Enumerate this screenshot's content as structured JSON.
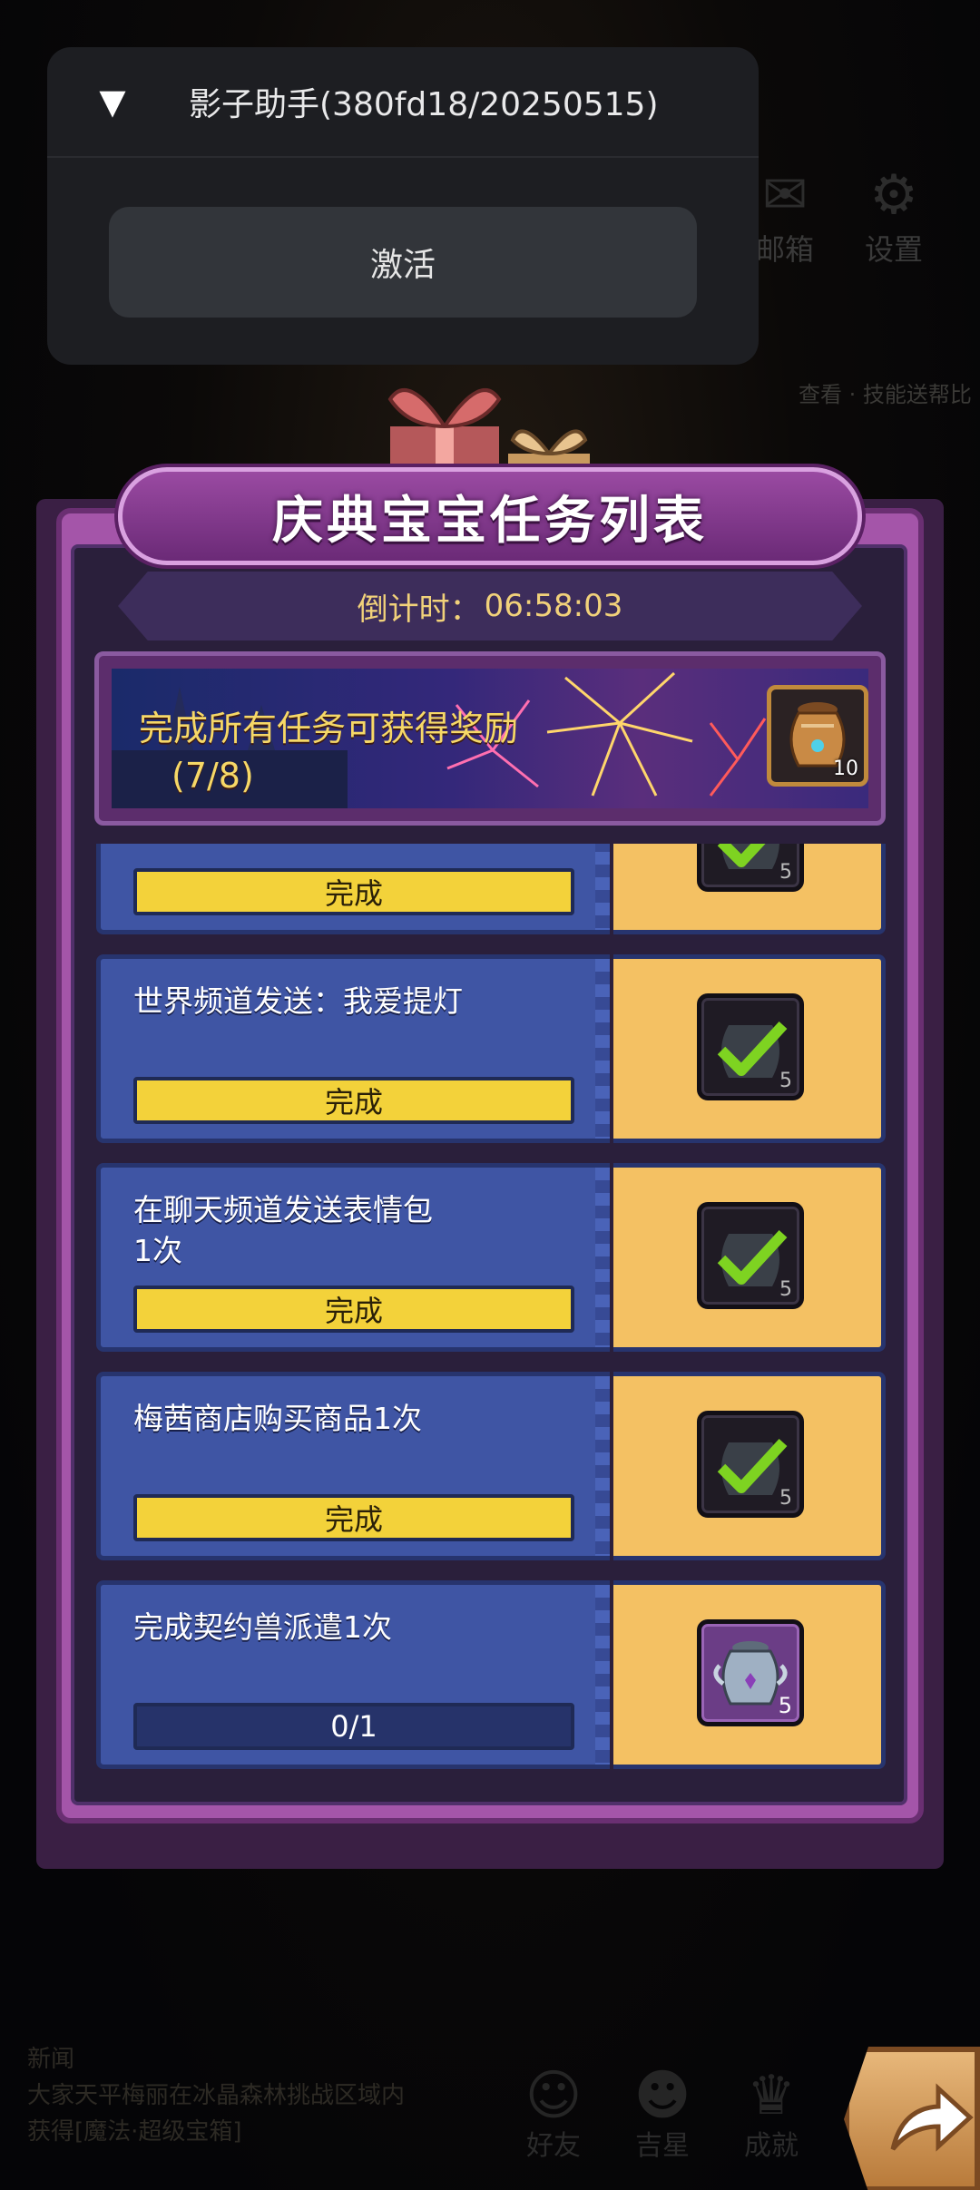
{
  "helper": {
    "toggle_icon": "▼",
    "title": "影子助手(380fd18/20250515)",
    "activate_label": "激活"
  },
  "background": {
    "mail_label": "邮箱",
    "settings_label": "设置",
    "side_text": "查看 · 技能送帮比",
    "news_label": "新闻",
    "news_text": "大家天平梅丽在冰晶森林挑战区域内获得[魔法·超级宝箱]",
    "nav_friends": "好友",
    "nav_pet": "吉星",
    "nav_achieve": "成就"
  },
  "panel": {
    "title": "庆典宝宝任务列表",
    "countdown_label": "倒计时：",
    "countdown_value": "06:58:03",
    "reward": {
      "text": "完成所有任务可获得奖励",
      "progress": "(7/8)",
      "item_icon": "golden-jar-icon",
      "item_qty": "10"
    },
    "tasks": [
      {
        "name": "",
        "status": "完成",
        "completed": true,
        "reward_qty": "5",
        "reward_icon": "checked-jar-icon"
      },
      {
        "name": "世界频道发送：我爱提灯",
        "status": "完成",
        "completed": true,
        "reward_qty": "5",
        "reward_icon": "checked-jar-icon"
      },
      {
        "name": "在聊天频道发送表情包\n1次",
        "status": "完成",
        "completed": true,
        "reward_qty": "5",
        "reward_icon": "checked-jar-icon"
      },
      {
        "name": "梅茜商店购买商品1次",
        "status": "完成",
        "completed": true,
        "reward_qty": "5",
        "reward_icon": "checked-jar-icon"
      },
      {
        "name": "完成契约兽派遣1次",
        "status": "0/1",
        "completed": false,
        "reward_qty": "5",
        "reward_icon": "silver-jar-icon"
      }
    ]
  },
  "colors": {
    "panel_purple": "#a455a9",
    "task_blue": "#3f55a4",
    "reward_gold": "#f4c163",
    "done_bar": "#f3d23a",
    "countdown_text": "#f1d17a"
  }
}
